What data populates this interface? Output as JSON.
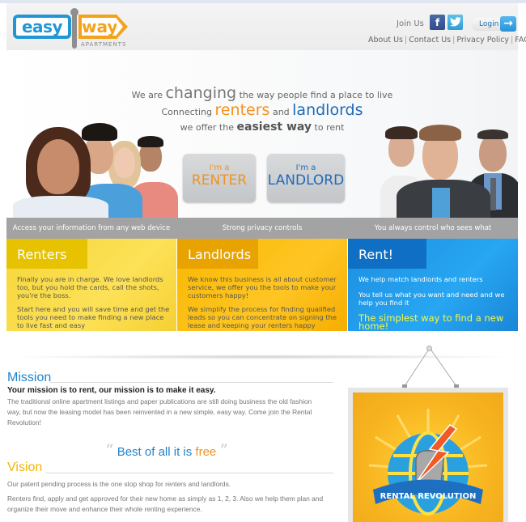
{
  "brand": {
    "logo_left": "easy",
    "logo_right": "way",
    "logo_sub": "APARTMENTS"
  },
  "header": {
    "join_label": "Join Us",
    "facebook_glyph": "f",
    "twitter_glyph": "t",
    "login_label": "Login",
    "login_arrow": "→",
    "nav": [
      "About Us",
      "Contact Us",
      "Privacy Policy",
      "FAQ"
    ],
    "nav_separator": "|"
  },
  "hero": {
    "line1_pre": "We are",
    "line1_big": "changing",
    "line1_post": "the way people find a place to live",
    "line2_pre": "Connecting",
    "line2_renters": "renters",
    "line2_and": "and",
    "line2_landlords": "landlords",
    "line3_pre": "we offer the",
    "line3_bold": "easiest way",
    "line3_post": "to rent",
    "renter_button": {
      "small": "I'm a",
      "large": "RENTER"
    },
    "landlord_button": {
      "small": "I'm a",
      "large": "LANDLORD"
    }
  },
  "features": [
    "Access your information from any web device",
    "Strong privacy controls",
    "You always control who sees what"
  ],
  "boxes": {
    "renters": {
      "title": "Renters",
      "p1": "Finally you are in charge. We love landlords too, but you hold the cards, call the shots, you're the boss.",
      "p2": "Start here and you will save time and get the tools you need to make finding a new place to live fast and easy"
    },
    "landlords": {
      "title": "Landlords",
      "p1": "We know this business is all about customer service, we offer you the tools to make your customers happy!",
      "p2": "We simplify the process for finding qualified leads so you can concentrate on signing the lease and keeping your renters happy"
    },
    "rent": {
      "title": "Rent!",
      "p1": "We help match landlords and renters",
      "p2": "You tell us what you want and need and we help you find it",
      "slogan": "The simplest way to find a new home!"
    }
  },
  "mission": {
    "title": "Mission",
    "lead": "Your mission is to rent, our mission is to make it easy.",
    "body": "The traditional online apartment listings and paper publications are still doing business the old fashion way, but now the leasing model has been reinvented in a new simple, easy way. Come join the Rental Revolution!"
  },
  "quote": {
    "open": "“",
    "text": "Best of all it is",
    "highlight": "free",
    "close": "”"
  },
  "vision": {
    "title": "Vision",
    "p1": "Our patent pending process is the one stop shop for renters and landlords.",
    "p2": "Renters find, apply and get approved for their new home as simply as 1, 2, 3. Also we help them plan and organize their move and enhance their whole renting experience."
  },
  "poster": {
    "banner_text": "RENTAL REVOLUTION"
  },
  "colors": {
    "brand_blue": "#2196d6",
    "brand_orange": "#f5a21b",
    "renters_yellow": "#fde157",
    "landlords_orange": "#fec524",
    "rent_blue": "#27a6f2"
  }
}
